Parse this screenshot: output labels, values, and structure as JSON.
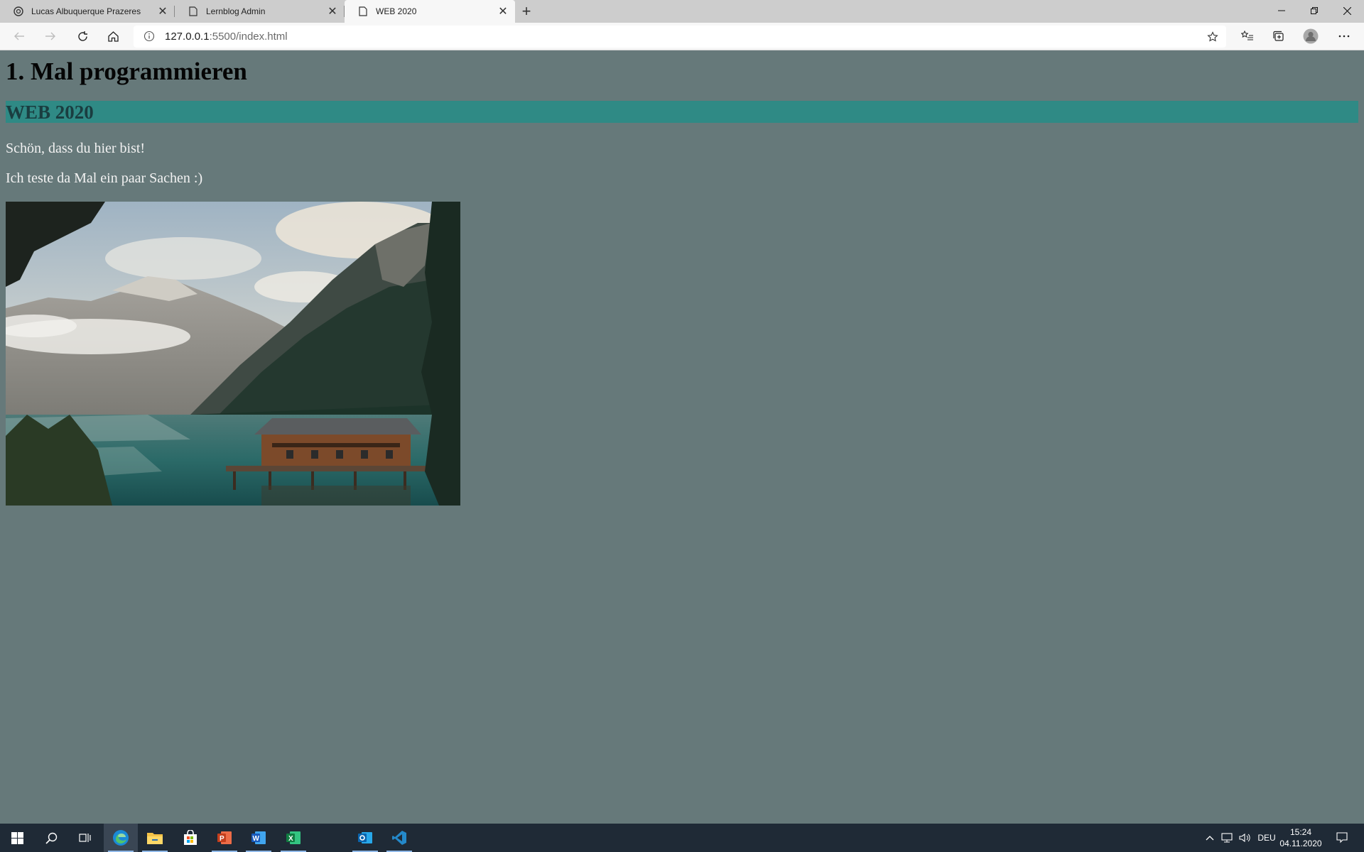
{
  "browser": {
    "tabs": [
      {
        "title": "Lucas Albuquerque Prazeres",
        "icon": "site-icon",
        "active": false
      },
      {
        "title": "Lernblog Admin",
        "icon": "page-icon",
        "active": false
      },
      {
        "title": "WEB 2020",
        "icon": "page-icon",
        "active": true
      }
    ],
    "address": {
      "host": "127.0.0.1",
      "path": ":5500/index.html"
    }
  },
  "page": {
    "heading": "1. Mal programmieren",
    "subheading": "WEB 2020",
    "paragraph1": "Schön, dass du hier bist!",
    "paragraph2": "Ich teste da Mal ein paar Sachen :)",
    "image_description_icon": "lake-mountain-boathouse-photo",
    "colors": {
      "background": "#66797a",
      "band": "#2f8a85",
      "heading": "#050505",
      "subheading": "#1a3d40",
      "text": "#f2f2f2"
    }
  },
  "taskbar": {
    "apps": [
      "start-icon",
      "search-icon",
      "task-view-icon",
      "edge-icon",
      "file-explorer-icon",
      "store-icon",
      "powerpoint-icon",
      "word-icon",
      "excel-icon",
      "outlook-icon",
      "vscode-icon"
    ],
    "language": "DEU",
    "time": "15:24",
    "date": "04.11.2020"
  }
}
